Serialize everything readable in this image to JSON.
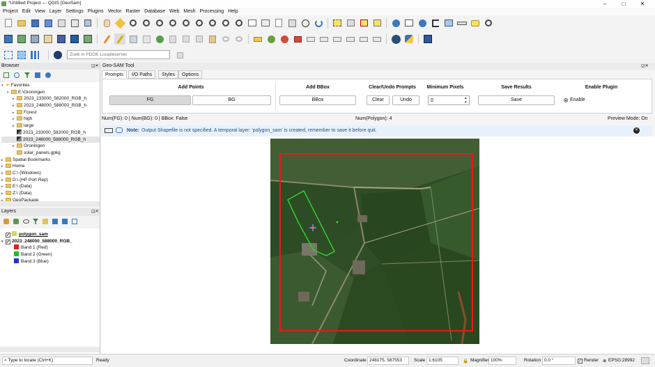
{
  "window": {
    "title": "*Untitled Project — QGIS [GeoSam]",
    "controls": [
      "–",
      "□",
      "✕"
    ]
  },
  "menu": [
    "Project",
    "Edit",
    "View",
    "Layer",
    "Settings",
    "Plugins",
    "Vector",
    "Raster",
    "Database",
    "Web",
    "Mesh",
    "Processing",
    "Help"
  ],
  "locator_toolbar": {
    "placeholder": "Zoek in PDOK Locatieserver"
  },
  "browser": {
    "title": "Browser",
    "items": [
      {
        "label": "Favorites",
        "level": 0,
        "icon": "star-icon"
      },
      {
        "label": "E:\\Groningen",
        "level": 1,
        "icon": "folder-icon"
      },
      {
        "label": "2023_233000_582000_RGB_h",
        "level": 2,
        "icon": "folder-icon"
      },
      {
        "label": "2023_248000_588000_RGB_h",
        "level": 2,
        "icon": "folder-icon"
      },
      {
        "label": "Forest",
        "level": 2,
        "icon": "folder-icon"
      },
      {
        "label": "high",
        "level": 2,
        "icon": "folder-icon"
      },
      {
        "label": "large",
        "level": 2,
        "icon": "folder-icon"
      },
      {
        "label": "2023_233000_582000_RGB_h",
        "level": 2,
        "icon": "raster-icon"
      },
      {
        "label": "2023_248000_588000_RGB_h",
        "level": 2,
        "icon": "raster-icon"
      },
      {
        "label": "Groningen",
        "level": 2,
        "icon": "project-icon"
      },
      {
        "label": "solar_panels.gpkg",
        "level": 2,
        "icon": "gpkg-icon"
      },
      {
        "label": "Spatial Bookmarks",
        "level": 0,
        "icon": "bookmark-icon"
      },
      {
        "label": "Home",
        "level": 0,
        "icon": "home-icon"
      },
      {
        "label": "C:\\ (Windows)",
        "level": 0,
        "icon": "drive-icon"
      },
      {
        "label": "D:\\ (HP Port Rep)",
        "level": 0,
        "icon": "drive-icon"
      },
      {
        "label": "E:\\ (Data)",
        "level": 0,
        "icon": "drive-icon"
      },
      {
        "label": "Z:\\ (Data)",
        "level": 0,
        "icon": "drive-icon"
      },
      {
        "label": "GeoPackage",
        "level": 0,
        "icon": "gpkg-icon"
      }
    ]
  },
  "layers": {
    "title": "Layers",
    "items": [
      {
        "label": "polygon_sam",
        "level": 0,
        "checked": true,
        "bold": true,
        "swatch": "#d9d36a"
      },
      {
        "label": "2023_248000_588000_RGB_",
        "level": 0,
        "checked": true,
        "bold": true,
        "swatch": ""
      },
      {
        "label": "Band 1 (Red)",
        "level": 1,
        "swatch": "#e0201e"
      },
      {
        "label": "Band 2 (Green)",
        "level": 1,
        "swatch": "#1fbf23"
      },
      {
        "label": "Band 3 (Blue)",
        "level": 1,
        "swatch": "#2130d8"
      }
    ]
  },
  "geosam": {
    "title": "Geo-SAM Tool",
    "tabs": [
      "Prompts",
      "I/O Paths",
      "Styles",
      "Options"
    ],
    "active_tab": "Prompts",
    "add_points": {
      "header": "Add Points",
      "fg": "FG",
      "bg": "BG"
    },
    "add_bbox": {
      "header": "Add BBox",
      "bbox": "BBox"
    },
    "clear_undo": {
      "header": "Clear/Undo Prompts",
      "clear": "Clear",
      "undo": "Undo"
    },
    "min_pixels": {
      "header": "Minimum Pixels",
      "value": "0"
    },
    "save_results": {
      "header": "Save Results",
      "save": "Save"
    },
    "enable_plugin": {
      "header": "Enable Plugin",
      "enable": "Enable"
    },
    "stats_left": "Num(FG): 0 | Num(BG): 0 | BBox: False",
    "stats_mid": "Num(Polygon): 4",
    "stats_right": "Preview Mode: On",
    "note_label": "Note:",
    "note_text": "Output Shapefile is not specified. A temporal layer: 'polygon_sam' is created, remember to save it before quit."
  },
  "statusbar": {
    "locate_placeholder": "Type to locate (Ctrl+K)",
    "ready": "Ready",
    "coordinate_label": "Coordinate",
    "coordinate_value": "248175, 587553",
    "scale_label": "Scale",
    "scale_value": "1:6105",
    "magnifier_label": "Magnifier",
    "magnifier_value": "100%",
    "rotation_label": "Rotation",
    "rotation_value": "0.0 °",
    "render_label": "Render",
    "crs_label": "EPSG:28992"
  },
  "colors": {
    "note_bg": "#e8f1fb",
    "bbox_red": "#e41a1c",
    "polygon_green": "#2fd12f",
    "fg_btn_bg": "#d8d8d8"
  }
}
